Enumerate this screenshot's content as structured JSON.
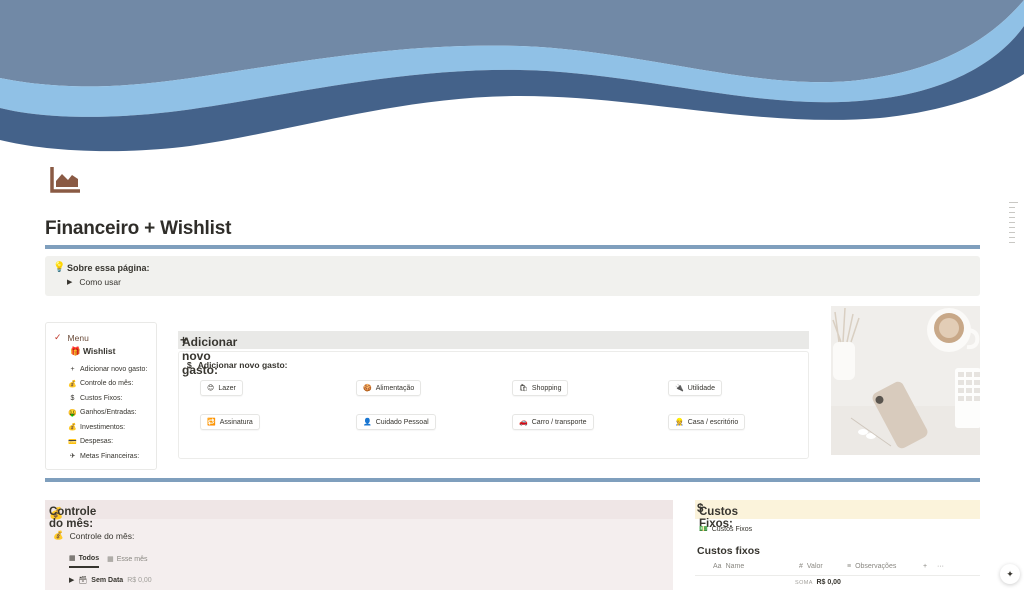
{
  "page": {
    "title": "Financeiro + Wishlist"
  },
  "callout": {
    "icon": "lightbulb-icon",
    "heading": "Sobre essa página:",
    "toggle_label": "Como usar"
  },
  "menu": {
    "header": "Menu",
    "wishlist": "Wishlist",
    "items": [
      {
        "icon": "plus-icon",
        "label": "Adicionar novo gasto:"
      },
      {
        "icon": "money-bag-icon",
        "label": "Controle do mês:"
      },
      {
        "icon": "dollar-icon",
        "label": "Custos Fixos:"
      },
      {
        "icon": "money-face-icon",
        "label": "Ganhos/Entradas:"
      },
      {
        "icon": "money-bag-icon",
        "label": "Investimentos:"
      },
      {
        "icon": "card-icon",
        "label": "Despesas:"
      },
      {
        "icon": "airplane-icon",
        "label": "Metas Financeiras:"
      }
    ]
  },
  "add_expense": {
    "section_title": "Adicionar novo gasto:",
    "box_title": "Adicionar novo gasto:",
    "buttons": [
      {
        "icon": "smile-icon",
        "label": "Lazer"
      },
      {
        "icon": "food-icon",
        "label": "Alimentação"
      },
      {
        "icon": "shopping-icon",
        "label": "Shopping"
      },
      {
        "icon": "tool-icon",
        "label": "Utilidade"
      },
      {
        "icon": "repeat-icon",
        "label": "Assinatura"
      },
      {
        "icon": "person-icon",
        "label": "Cuidado Pessoal"
      },
      {
        "icon": "car-icon",
        "label": "Carro / transporte"
      },
      {
        "icon": "worker-icon",
        "label": "Casa / escritório"
      }
    ]
  },
  "monthly": {
    "section_title": "Controle do mês:",
    "sub_title": "Controle do mês:",
    "tabs": [
      {
        "label": "Todos",
        "active": true
      },
      {
        "label": "Esse mês",
        "active": false
      }
    ],
    "group": {
      "label": "Sem Data",
      "amount": "R$ 0,00"
    }
  },
  "fixed_costs": {
    "section_title": "Custos Fixos:",
    "link_label": "Custos Fixos",
    "db_title": "Custos fixos",
    "columns": [
      {
        "prefix": "Aa",
        "label": "Name"
      },
      {
        "prefix": "#",
        "label": "Valor"
      },
      {
        "prefix": "≡",
        "label": "Observações"
      }
    ],
    "sum_label": "SOMA",
    "sum_value": "R$ 0,00"
  },
  "colors": {
    "cover_top": "#7189a6",
    "cover_light": "#90c1e6",
    "cover_dark": "#44628a",
    "rule": "#7f9fbd",
    "icon_brown": "#8a5a44",
    "monthly_bg": "#f4eeee",
    "fixed_bg": "#fbf3db"
  }
}
